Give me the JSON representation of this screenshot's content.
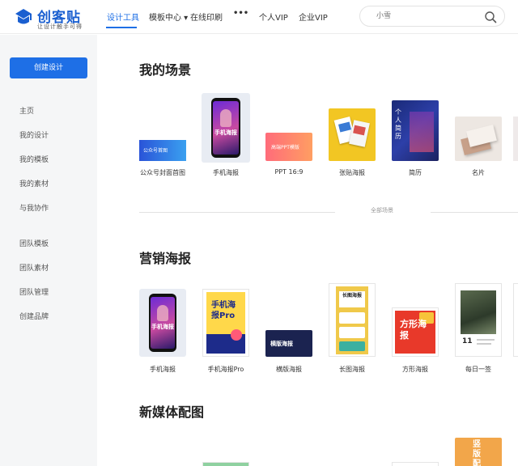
{
  "brand": {
    "name": "创客贴",
    "slogan": "让设计触手可得"
  },
  "nav": {
    "items": [
      {
        "label": "设计工具"
      },
      {
        "label": "模板中心 ▾"
      },
      {
        "label": "在线印刷"
      },
      {
        "label": "•••"
      },
      {
        "label": "个人VIP"
      },
      {
        "label": "企业VIP"
      }
    ]
  },
  "search": {
    "placeholder": "小雪"
  },
  "sidebar": {
    "create_label": "创建设计",
    "items": [
      {
        "label": "主页"
      },
      {
        "label": "我的设计"
      },
      {
        "label": "我的模板"
      },
      {
        "label": "我的素材"
      },
      {
        "label": "与我协作"
      },
      {
        "label": "团队模板"
      },
      {
        "label": "团队素材"
      },
      {
        "label": "团队管理"
      },
      {
        "label": "创建品牌"
      }
    ]
  },
  "scenes": {
    "title": "我的场景",
    "all_label": "全部场景",
    "cards": [
      {
        "label": "公众号封面首图",
        "thumb_text": "公众号首图"
      },
      {
        "label": "手机海报",
        "thumb_text": "手机海报"
      },
      {
        "label": "PPT 16:9",
        "thumb_text": "高端PPT模版"
      },
      {
        "label": "张贴海报",
        "thumb_text": ""
      },
      {
        "label": "简历",
        "thumb_text": "个人简历"
      },
      {
        "label": "名片",
        "thumb_text": ""
      }
    ]
  },
  "marketing": {
    "title": "营销海报",
    "cards": [
      {
        "label": "手机海报",
        "thumb_text": "手机海报"
      },
      {
        "label": "手机海报Pro",
        "thumb_text": "手机海报Pro"
      },
      {
        "label": "横版海报",
        "thumb_text": "横版海报"
      },
      {
        "label": "长图海报",
        "thumb_text": "长图海报"
      },
      {
        "label": "方形海报",
        "thumb_text": "方形海报"
      },
      {
        "label": "每日一签",
        "thumb_text": "11"
      }
    ]
  },
  "newmedia": {
    "title": "新媒体配图",
    "thumb_text": "竖版配图"
  },
  "colors": {
    "accent": "#1e6fe6",
    "sidebar_bg": "#f5f6f7"
  }
}
